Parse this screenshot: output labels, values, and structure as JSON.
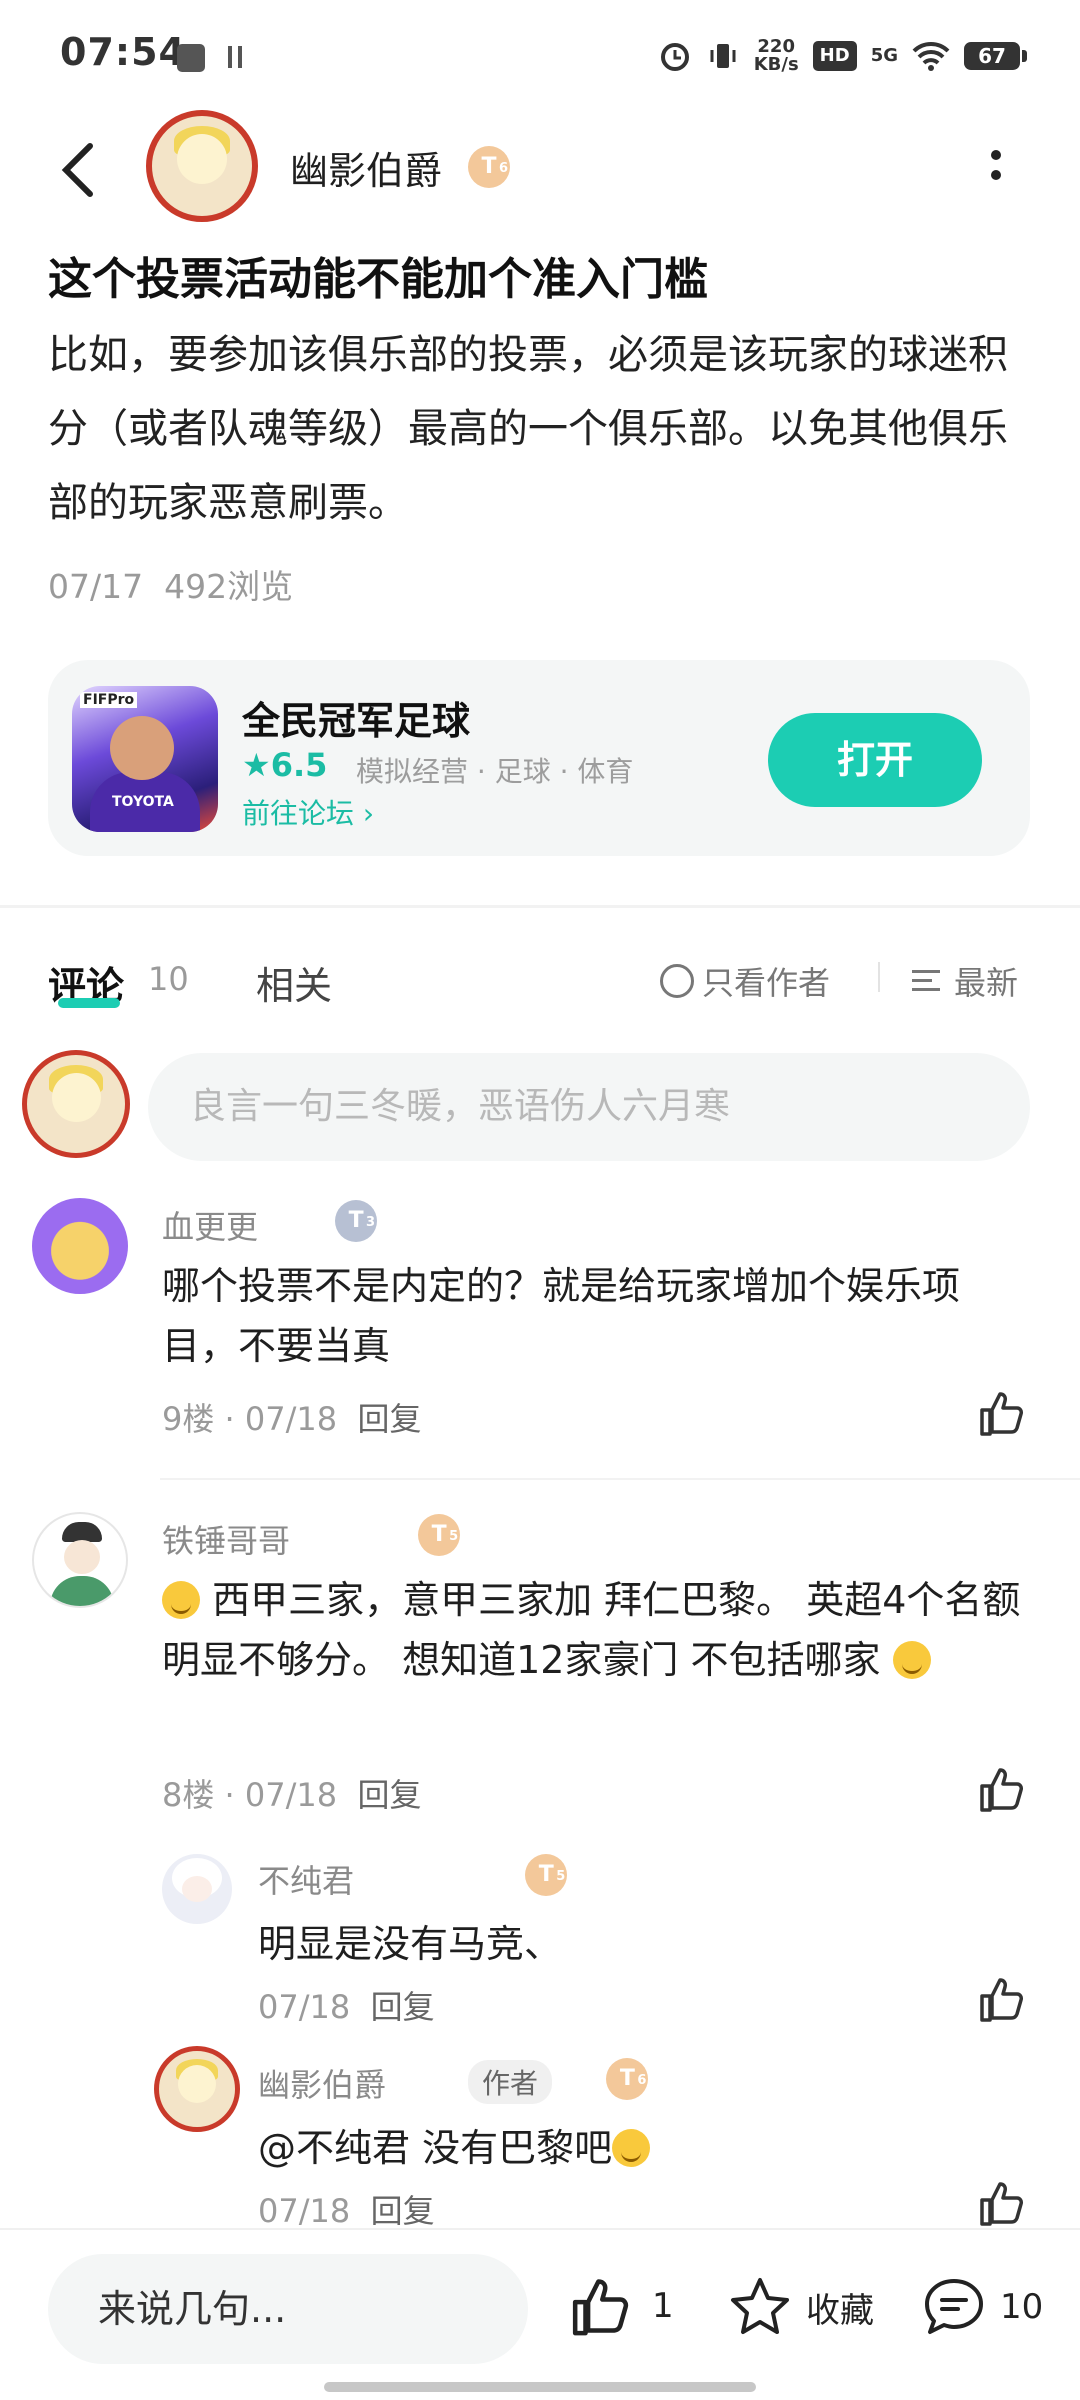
{
  "status_bar": {
    "time": "07:54",
    "speed_value": "220",
    "speed_unit": "KB/s",
    "hd": "HD",
    "network": "5G",
    "battery": "67"
  },
  "header": {
    "author_name": "幽影伯爵",
    "author_level": "T",
    "author_level_sub": "6"
  },
  "post": {
    "title": "这个投票活动能不能加个准入门槛",
    "body": "比如，要参加该俱乐部的投票，必须是该玩家的球迷积分（或者队魂等级）最高的一个俱乐部。以免其他俱乐部的玩家恶意刷票。",
    "date": "07/17",
    "views": "492浏览"
  },
  "game_card": {
    "name": "全民冠军足球",
    "score": "★6.5",
    "tags": "模拟经营 · 足球 · 体育",
    "forum_link": "前往论坛 ›",
    "open_label": "打开",
    "icon_logo": "FIFPro",
    "icon_brand": "TOYOTA"
  },
  "tabs": {
    "comments_label": "评论",
    "comments_count": "10",
    "related_label": "相关",
    "only_author": "只看作者",
    "sort": "最新"
  },
  "comment_input": {
    "placeholder": "良言一句三冬暖，恶语伤人六月寒"
  },
  "comments": [
    {
      "user": "血更更",
      "level": "T",
      "level_sub": "3",
      "text": "哪个投票不是内定的？就是给玩家增加个娱乐项目，不要当真",
      "floor": "9楼 · 07/18",
      "reply": "回复"
    },
    {
      "user": "铁锤哥哥",
      "level": "T",
      "level_sub": "5",
      "text_a": "西甲三家，意甲三家加 拜仁巴黎。 英超4个名额明显不够分。 想知道12家豪门 不包括哪家",
      "floor": "8楼 · 07/18",
      "reply": "回复",
      "replies": [
        {
          "user": "不纯君",
          "level": "T",
          "level_sub": "5",
          "text": "明显是没有马竞、",
          "date": "07/18",
          "reply": "回复"
        },
        {
          "user": "幽影伯爵",
          "level": "T",
          "level_sub": "6",
          "author_tag": "作者",
          "text": "@不纯君  没有巴黎吧",
          "date": "07/18",
          "reply": "回复"
        }
      ]
    }
  ],
  "bottom_bar": {
    "say_placeholder": "来说几句...",
    "like_count": "1",
    "favorite_label": "收藏",
    "comment_count": "10"
  }
}
